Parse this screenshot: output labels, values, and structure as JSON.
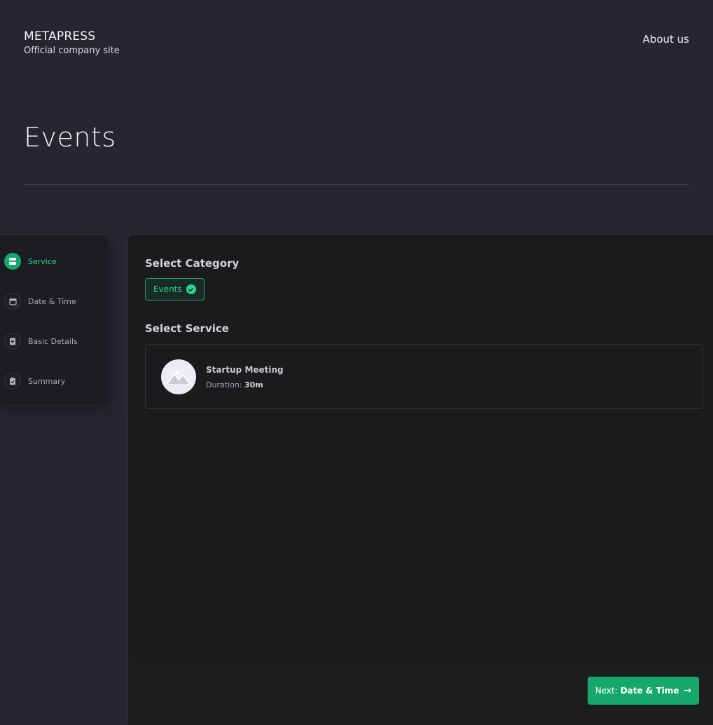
{
  "header": {
    "brand_name": "METAPRESS",
    "brand_tagline": "Official company site",
    "nav": {
      "about": "About us"
    }
  },
  "page": {
    "title": "Events"
  },
  "steps": [
    {
      "label": "Service",
      "icon": "server-icon",
      "active": true
    },
    {
      "label": "Date & Time",
      "icon": "calendar-icon",
      "active": false
    },
    {
      "label": "Basic Details",
      "icon": "document-icon",
      "active": false
    },
    {
      "label": "Summary",
      "icon": "clipboard-check-icon",
      "active": false
    }
  ],
  "main": {
    "category_heading": "Select Category",
    "category_selected": "Events",
    "service_heading": "Select Service",
    "services": [
      {
        "name": "Startup Meeting",
        "duration_label": "Duration:",
        "duration_value": "30m",
        "icon": "image-placeholder-icon"
      }
    ],
    "next_button": {
      "prefix": "Next:",
      "target": "Date & Time",
      "icon": "arrow-right-icon"
    }
  },
  "colors": {
    "accent": "#16a86a",
    "accent_text": "#27d88b",
    "background": "#262633",
    "panel": "#1b1b1e"
  }
}
